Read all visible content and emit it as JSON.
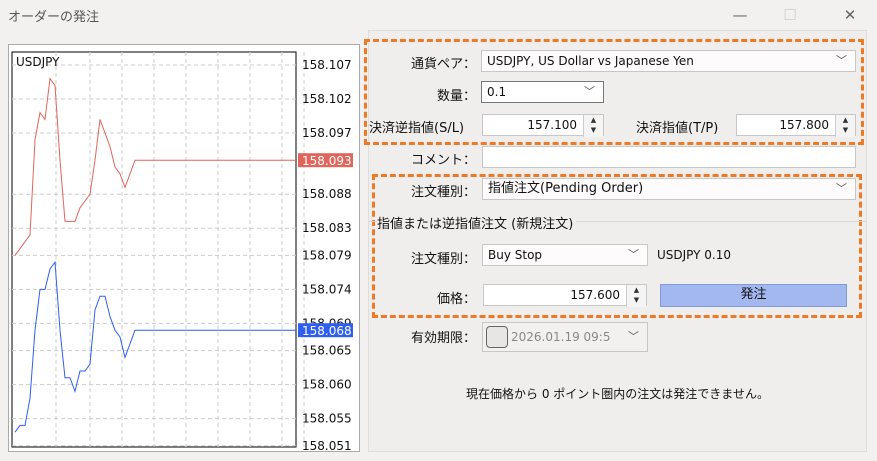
{
  "window": {
    "title": "オーダーの発注",
    "minimize_icon": "minimize-icon",
    "maximize_icon": "maximize-icon",
    "close_icon": "close-icon"
  },
  "chart": {
    "symbol": "USDJPY",
    "price_ticks": [
      "158.107",
      "158.102",
      "158.097",
      "158.093",
      "158.088",
      "158.083",
      "158.079",
      "158.074",
      "158.069",
      "158.068",
      "158.065",
      "158.060",
      "158.055",
      "158.051"
    ],
    "ask_label": "158.093",
    "bid_label": "158.068",
    "ask_color": "#e0665c",
    "bid_color": "#2f5ff0"
  },
  "chart_data": {
    "type": "line",
    "title": "USDJPY",
    "ylim": [
      158.051,
      158.107
    ],
    "grid": true,
    "series": [
      {
        "values": [
          158.079,
          158.08,
          158.081,
          158.082,
          158.096,
          158.1,
          158.099,
          158.105,
          158.104,
          158.093,
          158.084,
          158.084,
          158.084,
          158.086,
          158.087,
          158.088,
          158.093,
          158.099,
          158.097,
          158.095,
          158.092,
          158.091,
          158.089,
          158.091,
          158.093
        ]
      },
      {
        "values": [
          158.053,
          158.054,
          158.054,
          158.058,
          158.068,
          158.074,
          158.074,
          158.077,
          158.078,
          158.068,
          158.061,
          158.061,
          158.059,
          158.062,
          158.062,
          158.063,
          158.071,
          158.073,
          158.073,
          158.07,
          158.068,
          158.067,
          158.064,
          158.066,
          158.068
        ]
      }
    ]
  },
  "form": {
    "symbol_label": "通貨ペア：",
    "symbol_value": "USDJPY, US Dollar vs Japanese Yen",
    "volume_label": "数量：",
    "volume_value": "0.1",
    "sl_label": "決済逆指値(S/L)",
    "sl_value": "157.100",
    "tp_label": "決済指値(T/P)",
    "tp_value": "157.800",
    "comment_label": "コメント：",
    "comment_value": "",
    "type_label": "注文種別：",
    "type_value": "指値注文(Pending Order)",
    "group_label": "指値または逆指値注文 (新規注文)",
    "sub_type_label": "注文種別：",
    "sub_type_value": "Buy Stop",
    "sub_info": "USDJPY 0.10",
    "price_label": "価格：",
    "price_value": "157.600",
    "place_button": "発注",
    "expiry_label": "有効期限：",
    "expiry_value": "2026.01.19 09:5",
    "notice": "現在価格から 0 ポイント圏内の注文は発注できません。"
  }
}
